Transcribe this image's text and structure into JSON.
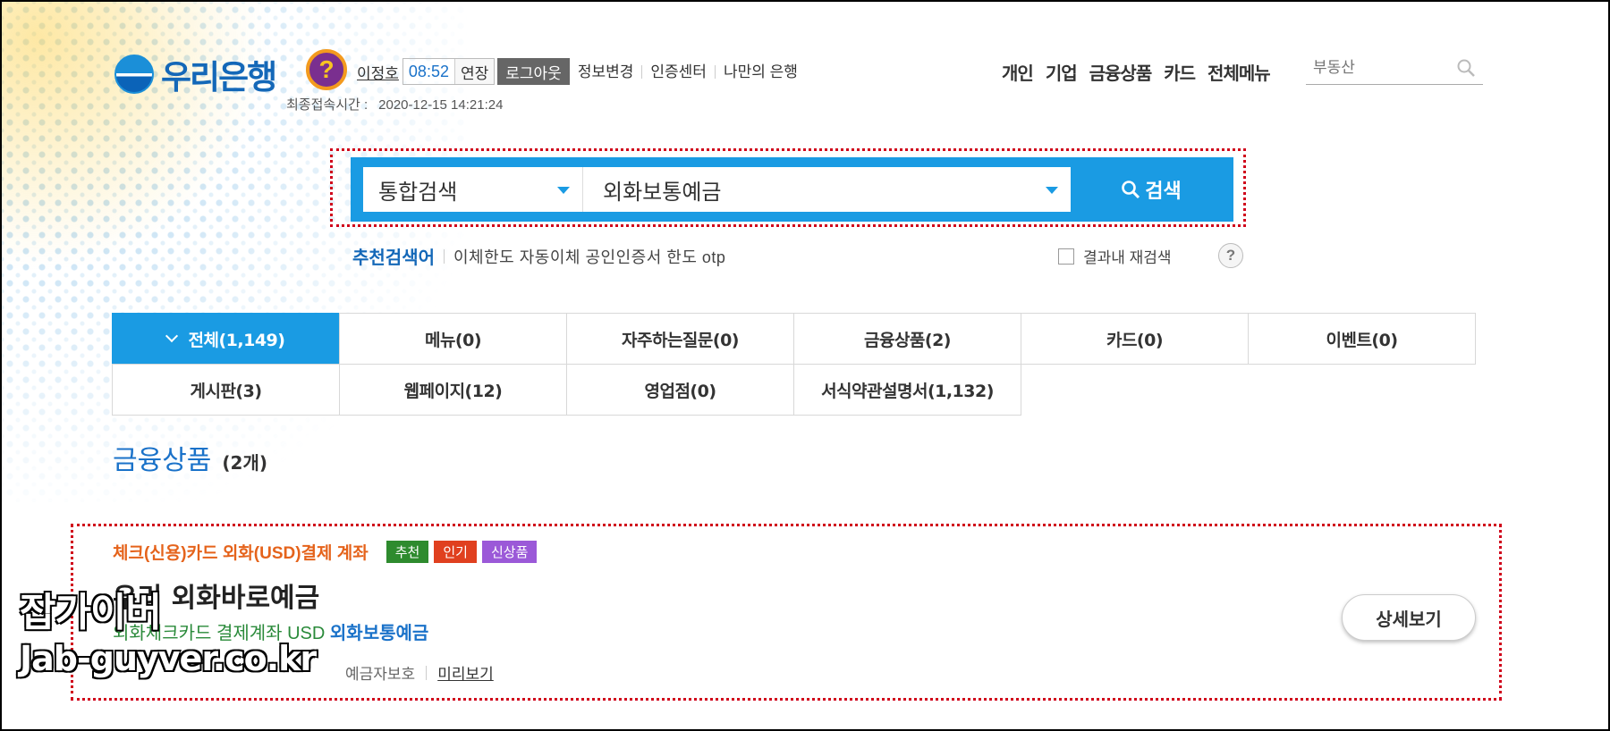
{
  "header": {
    "bank_name": "우리은행",
    "help_glyph": "?",
    "user_name": "이정호",
    "session_timer": "08:52",
    "extend_label": "연장",
    "logout_label": "로그아웃",
    "links": [
      "정보변경",
      "인증센터",
      "나만의 은행"
    ],
    "last_login_label": "최종접속시간 :",
    "last_login_value": "2020-12-15 14:21:24",
    "gnb": [
      "개인",
      "기업",
      "금융상품",
      "카드",
      "전체메뉴"
    ],
    "search_placeholder": "부동산",
    "search_icon": "search-icon"
  },
  "search": {
    "scope": "통합검색",
    "query": "외화보통예금",
    "button_label": "검색",
    "recommended_title": "추천검색어",
    "recommended_terms": "이체한도 자동이체 공인인증서 한도 otp",
    "refine_label": "결과내 재검색",
    "refine_checked": false,
    "help_glyph": "?",
    "accent_color": "#1a9be3"
  },
  "tabs": {
    "row1": [
      {
        "label": "전체(1,149)",
        "active": true
      },
      {
        "label": "메뉴(0)"
      },
      {
        "label": "자주하는질문(0)"
      },
      {
        "label": "금융상품(2)"
      },
      {
        "label": "카드(0)"
      },
      {
        "label": "이벤트(0)"
      }
    ],
    "row2": [
      {
        "label": "게시판(3)"
      },
      {
        "label": "웹페이지(12)"
      },
      {
        "label": "영업점(0)"
      },
      {
        "label": "서식약관설명서(1,132)"
      }
    ]
  },
  "section": {
    "title": "금융상품",
    "count": "(2개)"
  },
  "result": {
    "category": "체크(신용)카드 외화(USD)결제 계좌",
    "badges": [
      "추천",
      "인기",
      "신상품"
    ],
    "title": "우리 외화바로예금",
    "desc_prefix": "외화체크카드 결제계좌 USD ",
    "desc_highlight": "외화보통예금",
    "protection": "예금자보호",
    "preview_label": "미리보기",
    "detail_label": "상세보기"
  },
  "watermark": {
    "line1": "잡가이버",
    "line2": "Jab-guyver.co.kr"
  }
}
